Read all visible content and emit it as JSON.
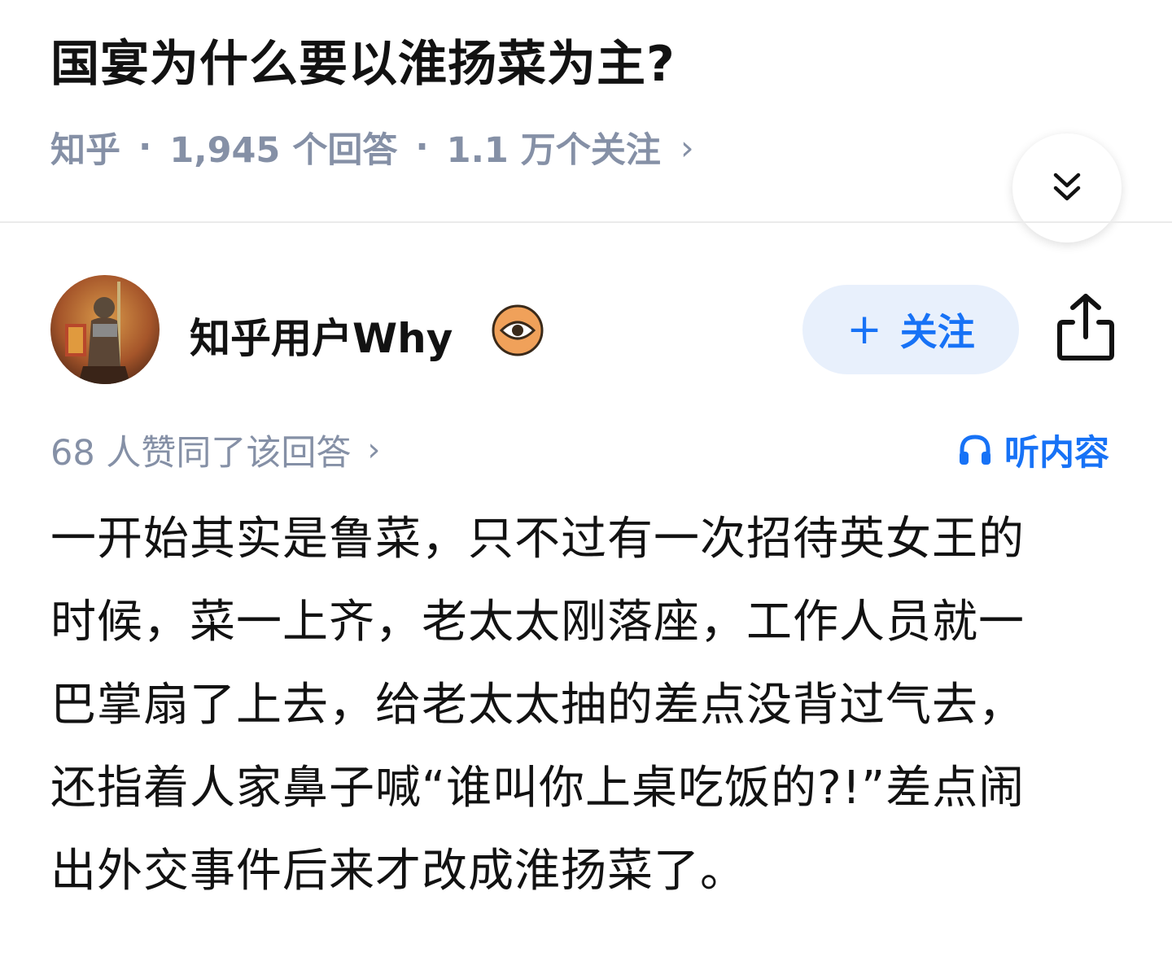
{
  "question": {
    "title": "国宴为什么要以淮扬菜为主?",
    "source": "知乎",
    "answer_count": "1,945 个回答",
    "follower_count": "1.1 万个关注"
  },
  "author": {
    "name": "知乎用户Why",
    "follow_label": "关注"
  },
  "vote": {
    "text": "68 人赞同了该回答"
  },
  "listen_label": "听内容",
  "answer": {
    "lines": [
      "一开始其实是鲁菜，只不过有一次招待英女王的",
      "时候，菜一上齐，老太太刚落座，工作人员就一",
      "巴掌扇了上去，给老太太抽的差点没背过气去，",
      "还指着人家鼻子喊“谁叫你上桌吃饭的?!”差点闹",
      "出外交事件后来才改成淮扬菜了。"
    ]
  },
  "icons": {
    "expand": "double-chevron-down-icon",
    "badge": "eye-icon",
    "share": "share-icon",
    "listen": "headphones-icon"
  },
  "colors": {
    "accent": "#1772f6",
    "follow_bg": "#e8f0fc",
    "meta_text": "#8590a6",
    "badge": "#f0a15a"
  }
}
